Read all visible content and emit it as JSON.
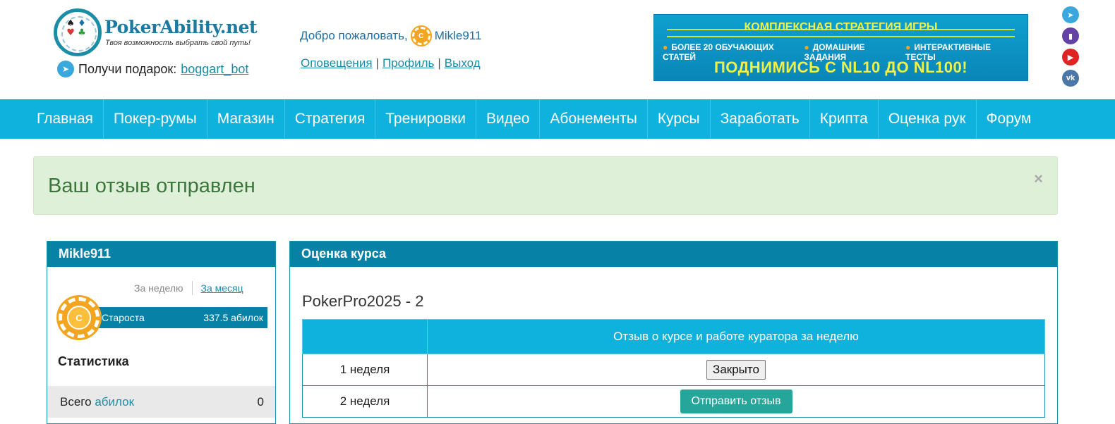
{
  "brand": {
    "name": "PokerAbility.net",
    "tagline": "Твоя возможность выбрать свой путь!"
  },
  "gift": {
    "label": "Получи подарок:",
    "bot": "boggart_bot"
  },
  "welcome": {
    "greeting": "Добро пожаловать,",
    "username": "Mikle911",
    "chip_letter": "C",
    "links": [
      "Оповещения",
      "Профиль",
      "Выход"
    ]
  },
  "banner": {
    "title": "КОМПЛЕКСНАЯ СТРАТЕГИЯ ИГРЫ",
    "features": [
      "БОЛЕЕ 20 ОБУЧАЮЩИХ СТАТЕЙ",
      "ДОМАШНИЕ ЗАДАНИЯ",
      "ИНТЕРАКТИВНЫЕ ТЕСТЫ"
    ],
    "cta": "ПОДНИМИСЬ С NL10 ДО NL100!"
  },
  "social": [
    "telegram-icon",
    "twitch-icon",
    "youtube-icon",
    "vk-icon"
  ],
  "nav": [
    "Главная",
    "Покер-румы",
    "Магазин",
    "Стратегия",
    "Тренировки",
    "Видео",
    "Абонементы",
    "Курсы",
    "Заработать",
    "Крипта",
    "Оценка рук",
    "Форум"
  ],
  "alert": {
    "message": "Ваш отзыв отправлен",
    "close": "×"
  },
  "user_panel": {
    "title": "Mikle911",
    "period_week": "За неделю",
    "period_month": "За месяц",
    "chip_letter": "C",
    "rank": "Староста",
    "points": "337.5 абилок",
    "stats_title": "Статистика",
    "stat_label_prefix": "Всего",
    "stat_label_link": "абилок",
    "stat_value": "0"
  },
  "course_panel": {
    "title": "Оценка курса",
    "course_name": "PokerPro2025 - 2",
    "table_header": [
      "",
      "Отзыв о курсе и работе куратора за неделю"
    ],
    "rows": [
      {
        "week": "1 неделя",
        "action": "Закрыто"
      },
      {
        "week": "2 неделя",
        "action": "Отправить отзыв"
      }
    ]
  },
  "colors": {
    "nav": "#0fb2dc",
    "panel_header": "#0781a6",
    "alert_bg": "#dff0d8",
    "alert_text": "#3c763d",
    "button_send": "#26a69a"
  }
}
